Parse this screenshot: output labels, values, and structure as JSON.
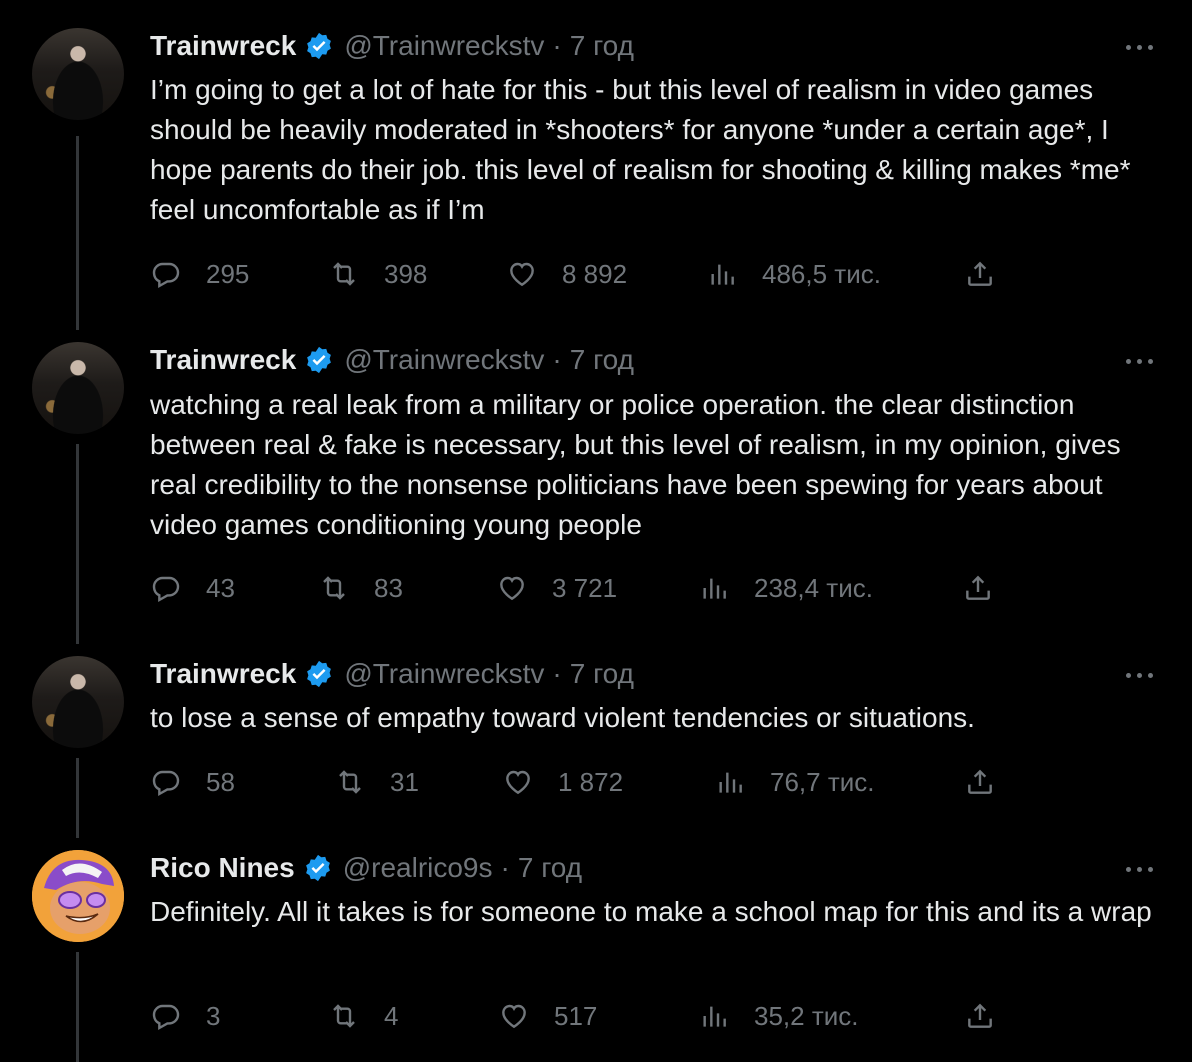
{
  "tweets": [
    {
      "name": "Trainwreck",
      "handle": "@Trainwreckstv",
      "time": "7 год",
      "text": "I’m going to get a lot of hate for this - but this level of realism in video games should be heavily moderated in *shooters* for anyone *under a certain age*, I hope parents do their job. this level of realism for shooting & killing makes *me* feel uncomfortable as if I’m",
      "replies": "295",
      "retweets": "398",
      "likes": "8 892",
      "views": "486,5 тис."
    },
    {
      "name": "Trainwreck",
      "handle": "@Trainwreckstv",
      "time": "7 год",
      "text": "watching a real leak from a military or police operation. the clear distinction between real & fake is necessary, but this level of realism, in my opinion, gives real credibility to the nonsense politicians have been spewing for years about video games conditioning young people",
      "replies": "43",
      "retweets": "83",
      "likes": "3 721",
      "views": "238,4 тис."
    },
    {
      "name": "Trainwreck",
      "handle": "@Trainwreckstv",
      "time": "7 год",
      "text": "to lose a sense of empathy toward violent tendencies or situations.",
      "replies": "58",
      "retweets": "31",
      "likes": "1 872",
      "views": "76,7 тис."
    },
    {
      "name": "Rico Nines",
      "handle": "@realrico9s",
      "time": "7 год",
      "text": "Definitely. All it takes is for someone to make a school map for this and its a wrap",
      "replies": "3",
      "retweets": "4",
      "likes": "517",
      "views": "35,2 тис."
    }
  ],
  "icons": {
    "verified": "verified-badge-icon",
    "more": "more-icon",
    "reply": "reply-icon",
    "retweet": "retweet-icon",
    "like": "heart-icon",
    "views": "views-icon",
    "share": "share-icon"
  },
  "colors": {
    "background": "#000000",
    "text": "#e7e9ea",
    "secondary": "#71767b",
    "verified": "#1d9bf0",
    "thread_line": "#333639"
  }
}
